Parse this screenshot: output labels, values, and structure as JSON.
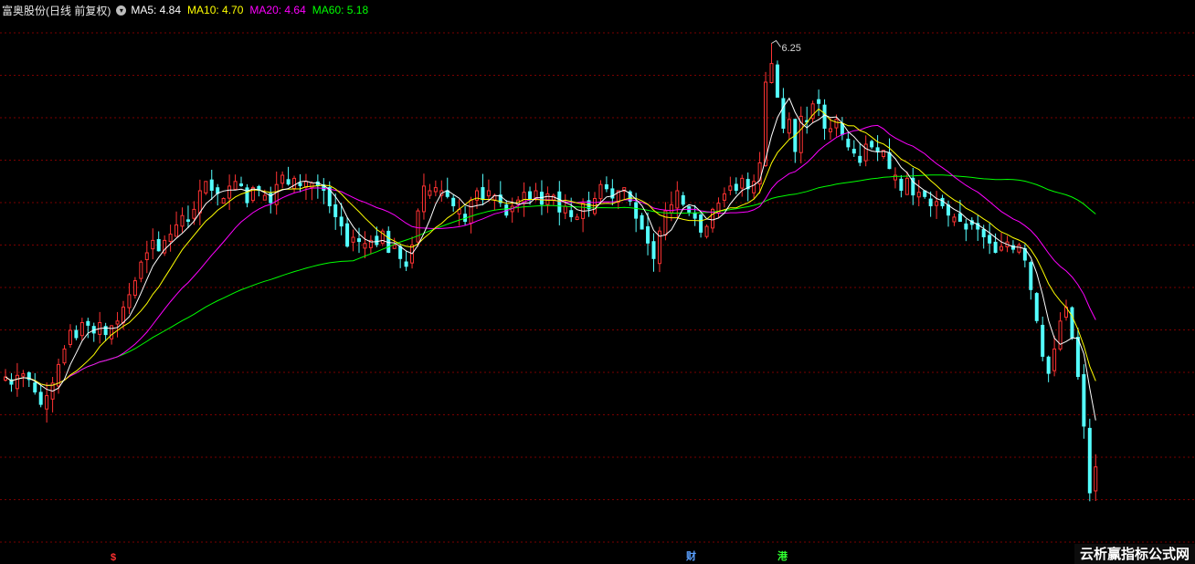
{
  "title_bar": {
    "stock_name": "富奥股份(日线 前复权)",
    "ma_items": [
      {
        "label": "MA5: 4.84",
        "color": "#ffffff"
      },
      {
        "label": "MA10: 4.70",
        "color": "#ffff00"
      },
      {
        "label": "MA20: 4.64",
        "color": "#ff00ff"
      },
      {
        "label": "MA60: 5.18",
        "color": "#00ff00"
      }
    ]
  },
  "peak_label": "6.25",
  "markers": [
    {
      "text": "$",
      "color": "#ff3030"
    },
    {
      "text": "财",
      "color": "#5aa0ff"
    },
    {
      "text": "港",
      "color": "#30ff30"
    }
  ],
  "watermark": "云析赢指标公式网",
  "colors": {
    "up": "#ff3232",
    "down": "#54ffff",
    "ma5": "#ffffff",
    "ma10": "#ffff00",
    "ma20": "#ff00ff",
    "ma60": "#00ff00",
    "grid": "#7a0000",
    "background": "#000000"
  },
  "chart_data": {
    "type": "candlestick",
    "interval": "daily",
    "price_range": [
      3.0,
      6.4
    ],
    "grid": true,
    "overlays": [
      "MA5",
      "MA10",
      "MA20",
      "MA60"
    ],
    "closes": [
      4.1,
      4.05,
      4.11,
      4.12,
      4.08,
      4.0,
      3.92,
      3.98,
      4.06,
      4.18,
      4.28,
      4.4,
      4.35,
      4.45,
      4.43,
      4.38,
      4.45,
      4.37,
      4.43,
      4.46,
      4.55,
      4.63,
      4.72,
      4.84,
      4.9,
      4.98,
      4.91,
      4.98,
      5.02,
      5.08,
      5.14,
      5.1,
      5.18,
      5.3,
      5.36,
      5.3,
      5.28,
      5.25,
      5.33,
      5.36,
      5.33,
      5.22,
      5.32,
      5.3,
      5.27,
      5.22,
      5.34,
      5.4,
      5.34,
      5.38,
      5.33,
      5.36,
      5.35,
      5.33,
      5.3,
      5.2,
      5.13,
      5.07,
      4.94,
      5.0,
      4.97,
      4.96,
      4.98,
      4.95,
      5.04,
      4.9,
      4.95,
      4.86,
      4.81,
      4.95,
      5.17,
      5.33,
      5.3,
      5.32,
      5.3,
      5.26,
      5.2,
      5.18,
      5.1,
      5.24,
      5.3,
      5.24,
      5.3,
      5.27,
      5.22,
      5.14,
      5.2,
      5.24,
      5.29,
      5.24,
      5.3,
      5.21,
      5.28,
      5.27,
      5.16,
      5.2,
      5.13,
      5.13,
      5.22,
      5.18,
      5.25,
      5.34,
      5.31,
      5.25,
      5.3,
      5.32,
      5.23,
      5.12,
      5.05,
      4.96,
      4.86,
      5.04,
      5.17,
      5.21,
      5.3,
      5.21,
      5.16,
      5.12,
      5.03,
      5.07,
      5.18,
      5.22,
      5.28,
      5.33,
      5.3,
      5.38,
      5.31,
      5.36,
      5.48,
      6.0,
      6.12,
      5.9,
      5.7,
      5.76,
      5.55,
      5.78,
      5.74,
      5.86,
      5.86,
      5.7,
      5.7,
      5.76,
      5.66,
      5.58,
      5.54,
      5.48,
      5.6,
      5.58,
      5.55,
      5.56,
      5.44,
      5.4,
      5.3,
      5.38,
      5.27,
      5.29,
      5.26,
      5.2,
      5.23,
      5.2,
      5.14,
      5.13,
      5.1,
      5.05,
      5.08,
      5.05,
      5.0,
      4.96,
      4.9,
      4.94,
      4.97,
      4.92,
      4.95,
      4.85,
      4.66,
      4.46,
      4.23,
      4.12,
      4.28,
      4.46,
      4.55,
      4.35,
      4.1,
      3.78,
      3.35,
      3.52
    ],
    "summary": {
      "peak_high": 6.25,
      "last_ma": {
        "MA5": 4.84,
        "MA10": 4.7,
        "MA20": 4.64,
        "MA60": 5.18
      }
    }
  }
}
